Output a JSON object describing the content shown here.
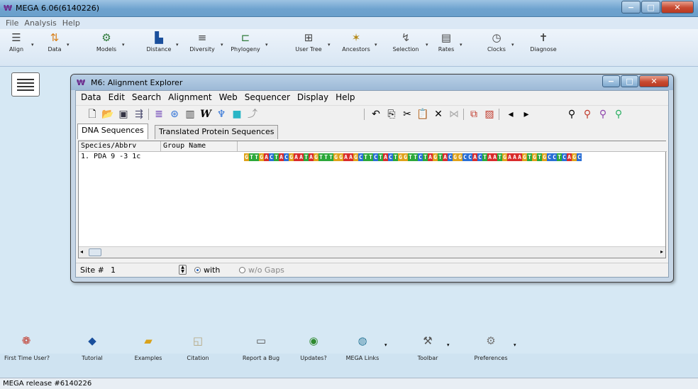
{
  "main_window": {
    "title": "MEGA 6.06(6140226)",
    "logo_glyph": "₩",
    "menu": [
      "File",
      "Analysis",
      "Help"
    ]
  },
  "toolbar": [
    {
      "label": "Align",
      "icon": "align-icon",
      "glyph": "☰"
    },
    {
      "label": "Data",
      "icon": "data-icon",
      "glyph": "⇅"
    },
    {
      "label": "Models",
      "icon": "models-icon",
      "glyph": "⚙"
    },
    {
      "label": "Distance",
      "icon": "distance-icon",
      "glyph": "▙"
    },
    {
      "label": "Diversity",
      "icon": "diversity-icon",
      "glyph": "≡"
    },
    {
      "label": "Phylogeny",
      "icon": "phylogeny-icon",
      "glyph": "⊏"
    },
    {
      "label": "User Tree",
      "icon": "user-tree-icon",
      "glyph": "⊞"
    },
    {
      "label": "Ancestors",
      "icon": "ancestors-icon",
      "glyph": "✶"
    },
    {
      "label": "Selection",
      "icon": "selection-icon",
      "glyph": "↯"
    },
    {
      "label": "Rates",
      "icon": "rates-icon",
      "glyph": "▤"
    },
    {
      "label": "Clocks",
      "icon": "clocks-icon",
      "glyph": "◷"
    },
    {
      "label": "Diagnose",
      "icon": "diagnose-icon",
      "glyph": "✝"
    }
  ],
  "alignment_explorer": {
    "title": "M6: Alignment Explorer",
    "menu": [
      "Data",
      "Edit",
      "Search",
      "Alignment",
      "Web",
      "Sequencer",
      "Display",
      "Help"
    ],
    "tabs": [
      "DNA Sequences",
      "Translated Protein Sequences"
    ],
    "columns": [
      "Species/Abbrv",
      "Group Name"
    ],
    "rows": [
      {
        "label": "1. PDA 9 -3 1c",
        "group": ""
      }
    ],
    "sequence": "GTTGACTACGAATAGTTTGGAAGCTTCTACTGGTTCTAGTACGGCCACTAATGAAAGTGTGCCTCAGC",
    "base_colors": {
      "A": "#d92b2b",
      "C": "#2a6fd6",
      "G": "#e0a21a",
      "T": "#2ca83a"
    },
    "site_label": "Site #",
    "site_value": "1",
    "radio_with": "with",
    "radio_without": "w/o Gaps"
  },
  "quickbar": [
    {
      "label": "First Time User?",
      "icon": "first-time-user-icon",
      "glyph": "❁",
      "color": "#c0392b"
    },
    {
      "label": "Tutorial",
      "icon": "tutorial-icon",
      "glyph": "◆",
      "color": "#1a4f9c"
    },
    {
      "label": "Examples",
      "icon": "examples-icon",
      "glyph": "▰",
      "color": "#d9a21b"
    },
    {
      "label": "Citation",
      "icon": "citation-icon",
      "glyph": "◱",
      "color": "#b5a680"
    },
    {
      "label": "Report a Bug",
      "icon": "report-bug-icon",
      "glyph": "▭",
      "color": "#555555"
    },
    {
      "label": "Updates?",
      "icon": "updates-icon",
      "glyph": "◉",
      "color": "#2f8a2f"
    },
    {
      "label": "MEGA Links",
      "icon": "mega-links-icon",
      "glyph": "◍",
      "color": "#2f7a9a"
    },
    {
      "label": "Toolbar",
      "icon": "toolbar-icon",
      "glyph": "⚒",
      "color": "#555555"
    },
    {
      "label": "Preferences",
      "icon": "preferences-icon",
      "glyph": "⚙",
      "color": "#777777"
    }
  ],
  "status_bar": "MEGA release #6140226"
}
